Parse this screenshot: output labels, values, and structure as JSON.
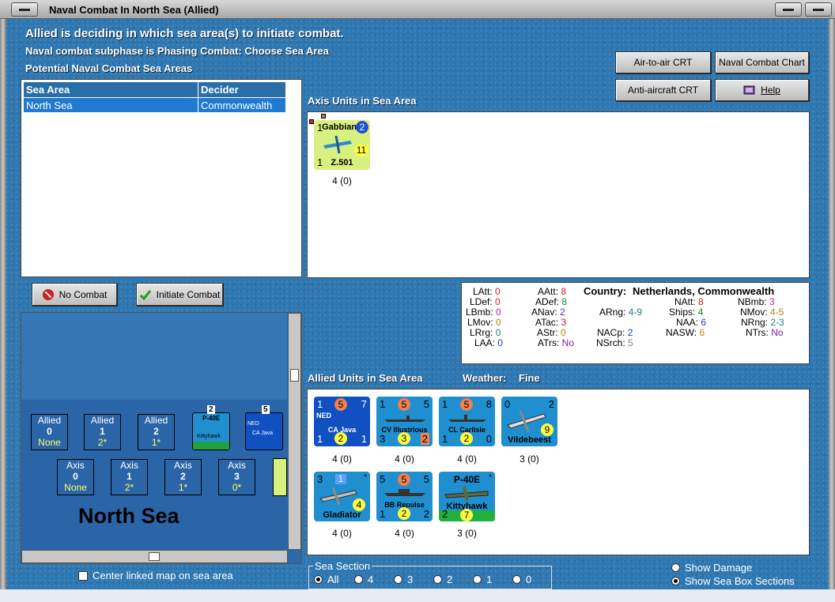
{
  "window": {
    "title": "Naval Combat In North Sea (Allied)"
  },
  "header": {
    "line1": "Allied is deciding in which sea area(s) to initiate combat.",
    "line2": "Naval combat subphase is Phasing Combat: Choose Sea Area",
    "line3": "Potential Naval Combat Sea Areas"
  },
  "buttons": {
    "air_to_air": "Air-to-air CRT",
    "naval_chart": "Naval Combat Chart",
    "anti_aircraft": "Anti-aircraft CRT",
    "help": "Help",
    "no_combat": "No Combat",
    "initiate_combat": "Initiate Combat"
  },
  "sea_table": {
    "headers": [
      "Sea Area",
      "Decider"
    ],
    "rows": [
      [
        "North Sea",
        "Commonwealth"
      ]
    ]
  },
  "axis_label": "Axis Units in Sea Area",
  "axis_units": [
    {
      "name": "Gabbiano",
      "id": "Z.501",
      "tl": "1",
      "circle": "2",
      "yellow": "11",
      "bl": "1",
      "count": "4 (0)"
    }
  ],
  "stats": {
    "country_label": "Country:",
    "country": "Netherlands, Commonwealth",
    "LAtt": "0",
    "LDef": "0",
    "LBmb": "0",
    "LMov": "0",
    "LRrg": "0",
    "LAA": "0",
    "AAtt": "8",
    "ADef": "8",
    "ANav": "2",
    "ATac": "3",
    "AStr": "0",
    "ATrs": "No",
    "ARng": "4-9",
    "NACp": "2",
    "NSrch": "5",
    "NAtt": "8",
    "Ships": "4",
    "NAA": "6",
    "NASW": "6",
    "NBmb": "3",
    "NMov": "4-5",
    "NRng": "2-3",
    "NTrs": "No"
  },
  "allied_label": "Allied Units in Sea Area",
  "weather_label": "Weather:",
  "weather": "Fine",
  "allied_units": [
    {
      "name": "CA Java",
      "tag": "NED",
      "tl": "1",
      "tc": "5",
      "tr": "7",
      "bl": "1",
      "bc": "2",
      "br": "1",
      "count": "4 (0)"
    },
    {
      "name": "CV Illustrious",
      "tl": "1",
      "tc": "5",
      "tr": "5",
      "bl": "3",
      "bc": "3",
      "br": "2",
      "count": "4 (0)"
    },
    {
      "name": "CL Carlisle",
      "tl": "1",
      "tc": "5",
      "tr": "8",
      "bl": "1",
      "bc": "2",
      "br": "0",
      "count": "4 (0)"
    },
    {
      "name": "Vildebeest",
      "tl": "0",
      "tr": "2",
      "yellow": "9",
      "count": "3 (0)"
    },
    {
      "name": "Gladiator",
      "tl": "3",
      "tc": "1",
      "yellow": "4",
      "count": "4 (0)"
    },
    {
      "name": "BB Repulse",
      "tl": "5",
      "tc": "5",
      "tr": "5",
      "bl": "1",
      "bc": "2",
      "br": "2",
      "count": "4 (0)"
    },
    {
      "name": "Kittyhawk",
      "model": "P-40E",
      "bl": "2",
      "bc": "7",
      "count": "3 (0)"
    }
  ],
  "map": {
    "sea_name": "North Sea",
    "allied_boxes": [
      {
        "l": "Allied",
        "v": "0",
        "s": "None"
      },
      {
        "l": "Allied",
        "v": "1",
        "s": "2*"
      },
      {
        "l": "Allied",
        "v": "2",
        "s": "1*"
      }
    ],
    "axis_boxes": [
      {
        "l": "Axis",
        "v": "0",
        "s": "None"
      },
      {
        "l": "Axis",
        "v": "1",
        "s": "2*"
      },
      {
        "l": "Axis",
        "v": "2",
        "s": "1*"
      },
      {
        "l": "Axis",
        "v": "3",
        "s": "0*"
      }
    ],
    "stack1_count": "2",
    "stack2_count": "5",
    "mini1": "P-40E",
    "mini1b": "Kittyhawk",
    "mini2": "CA Java",
    "mini2tag": "NED"
  },
  "center_map": "Center linked map on sea area",
  "sea_section": {
    "title": "Sea Section",
    "options": [
      "All",
      "4",
      "3",
      "2",
      "1",
      "0"
    ]
  },
  "show_damage": "Show Damage",
  "show_sections": "Show Sea Box Sections"
}
